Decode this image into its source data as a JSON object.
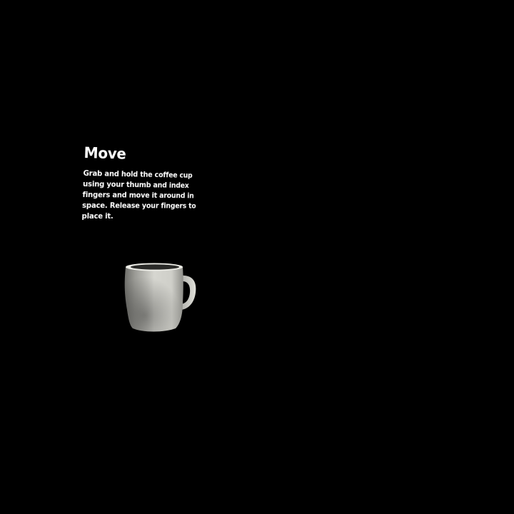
{
  "tip": {
    "title": "Move",
    "body": "Grab and hold the coffee cup using your thumb and index fingers and move it around in space. Release your fingers to place it."
  },
  "colors": {
    "background": "#000000",
    "text": "#ffffff",
    "mug_light": "#d8d8d2",
    "mug_shadow": "#4a4a46"
  },
  "icons": {
    "mug": "coffee-mug-icon"
  }
}
